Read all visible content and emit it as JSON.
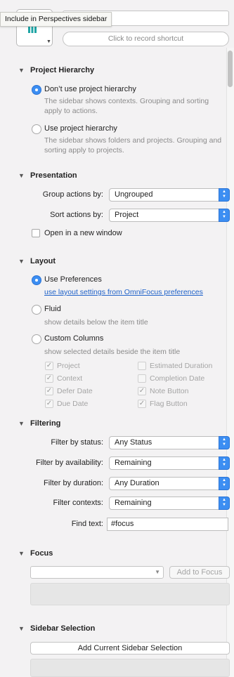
{
  "header": {
    "tooltip": "Include in Perspectives sidebar",
    "icon": "perspective-icon",
    "icon_color": "#1fa5a5",
    "shortcut_placeholder": "Click to record shortcut"
  },
  "project_hierarchy": {
    "title": "Project Hierarchy",
    "option1": {
      "label": "Don’t use project hierarchy",
      "hint": "The sidebar shows contexts. Grouping and sorting apply to actions.",
      "selected": true
    },
    "option2": {
      "label": "Use project hierarchy",
      "hint": "The sidebar shows folders and projects. Grouping and sorting apply to projects.",
      "selected": false
    }
  },
  "presentation": {
    "title": "Presentation",
    "group_label": "Group actions by:",
    "group_value": "Ungrouped",
    "sort_label": "Sort actions by:",
    "sort_value": "Project",
    "new_window_label": "Open in a new window"
  },
  "layout": {
    "title": "Layout",
    "use_prefs_label": "Use Preferences",
    "use_prefs_link": "use layout settings from OmniFocus preferences",
    "fluid_label": "Fluid",
    "fluid_hint": "show details below the item title",
    "custom_label": "Custom Columns",
    "custom_hint": "show selected details beside the item title",
    "columns": [
      {
        "label": "Project",
        "checked": true
      },
      {
        "label": "Estimated Duration",
        "checked": false
      },
      {
        "label": "Context",
        "checked": true
      },
      {
        "label": "Completion Date",
        "checked": false
      },
      {
        "label": "Defer Date",
        "checked": true
      },
      {
        "label": "Note Button",
        "checked": true
      },
      {
        "label": "Due Date",
        "checked": true
      },
      {
        "label": "Flag Button",
        "checked": true
      }
    ]
  },
  "filtering": {
    "title": "Filtering",
    "status_label": "Filter by status:",
    "status_value": "Any Status",
    "availability_label": "Filter by availability:",
    "availability_value": "Remaining",
    "duration_label": "Filter by duration:",
    "duration_value": "Any Duration",
    "contexts_label": "Filter contexts:",
    "contexts_value": "Remaining",
    "find_label": "Find text:",
    "find_value": "#focus"
  },
  "focus": {
    "title": "Focus",
    "combo_value": "",
    "add_button": "Add to Focus"
  },
  "sidebar_selection": {
    "title": "Sidebar Selection",
    "add_button": "Add Current Sidebar Selection"
  },
  "accent_color": "#3c8ef2"
}
